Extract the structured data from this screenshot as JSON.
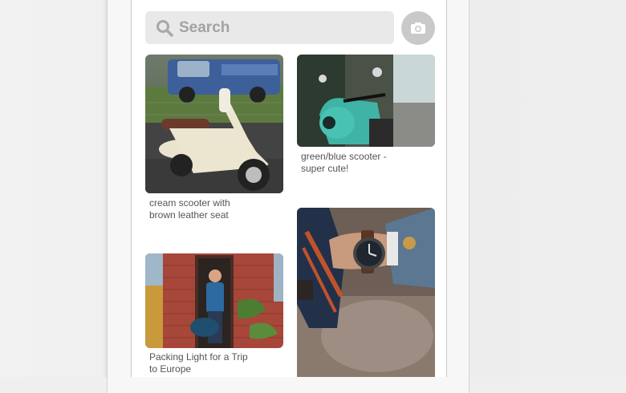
{
  "search": {
    "placeholder": "Search"
  },
  "colors": {
    "search_bg": "#e9e9e9",
    "camera_bg": "#c9c9c9",
    "caption": "#555555"
  },
  "icons": {
    "search": "search-icon",
    "camera": "camera-icon"
  },
  "pins": [
    {
      "caption_line1": "cream scooter with",
      "caption_line2": "brown leather seat"
    },
    {
      "caption_line1": "green/blue scooter -",
      "caption_line2": "super cute!"
    },
    {
      "caption_line1": "Packing Light for a Trip",
      "caption_line2": "to Europe"
    },
    {
      "caption_line1": "",
      "caption_line2": ""
    }
  ]
}
